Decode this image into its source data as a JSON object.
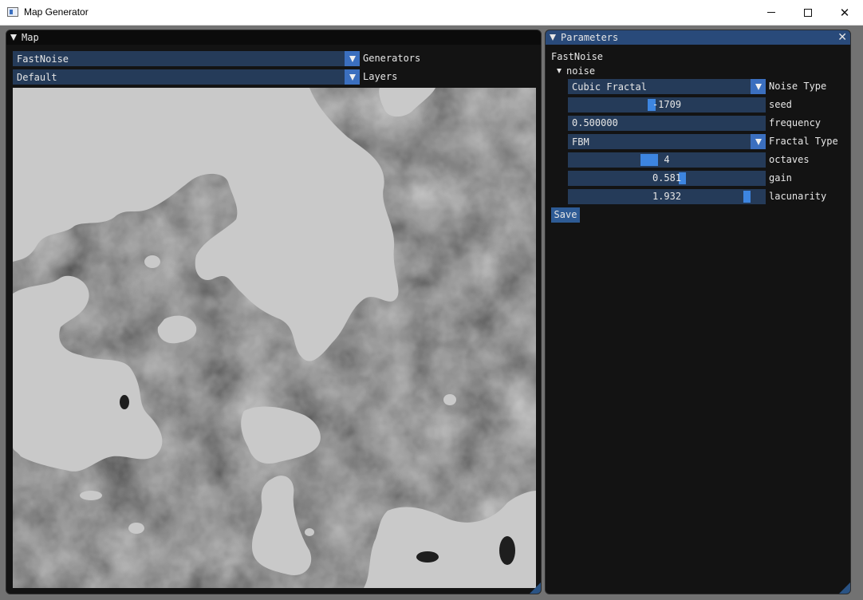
{
  "window": {
    "title": "Map Generator"
  },
  "map_panel": {
    "title": "Map",
    "generator_combo": {
      "value": "FastNoise",
      "label": "Generators"
    },
    "layer_combo": {
      "value": "Default",
      "label": "Layers"
    }
  },
  "params_panel": {
    "title": "Parameters",
    "generator_name": "FastNoise",
    "noise_node": "noise",
    "noise_type": {
      "value": "Cubic Fractal",
      "label": "Noise Type"
    },
    "seed": {
      "value": "-1709",
      "label": "seed",
      "slider_fraction": 0.5
    },
    "frequency": {
      "value": "0.500000",
      "label": "frequency"
    },
    "fractal_type": {
      "value": "FBM",
      "label": "Fractal Type"
    },
    "octaves": {
      "value": "4",
      "label": "octaves",
      "slider_fraction": 0.45
    },
    "gain": {
      "value": "0.581",
      "label": "gain",
      "slider_fraction": 0.58
    },
    "lacunarity": {
      "value": "1.932",
      "label": "lacunarity",
      "slider_fraction": 0.97
    },
    "save_label": "Save"
  },
  "colors": {
    "accent": "#3d85e0",
    "frame_bg": "#253b59",
    "title_active": "#294a7a"
  }
}
